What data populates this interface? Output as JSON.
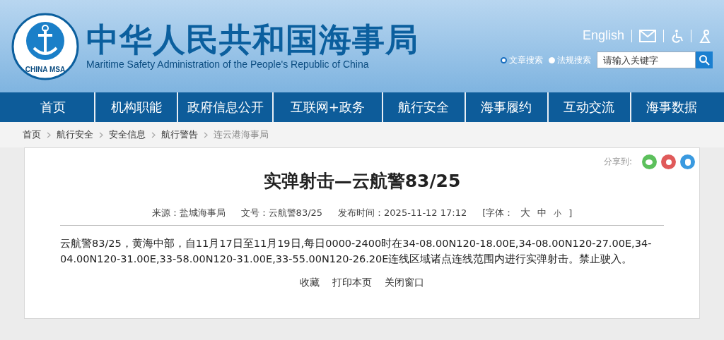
{
  "header": {
    "logo_text": "CHINA MSA",
    "title": "中华人民共和国海事局",
    "subtitle": "Maritime Safety Administration of the People's Republic of China",
    "language_link": "English",
    "search_scopes": [
      {
        "label": "文章搜索",
        "selected": true
      },
      {
        "label": "法规搜索",
        "selected": false
      }
    ],
    "search": {
      "placeholder": "请输入关键字"
    }
  },
  "nav": [
    {
      "label": "首页"
    },
    {
      "label": "机构职能"
    },
    {
      "label": "政府信息公开"
    },
    {
      "label": "互联网+政务"
    },
    {
      "label": "航行安全"
    },
    {
      "label": "海事履约"
    },
    {
      "label": "互动交流"
    },
    {
      "label": "海事数据"
    }
  ],
  "breadcrumb": [
    "首页",
    "航行安全",
    "安全信息",
    "航行警告",
    "连云港海事局"
  ],
  "article": {
    "share_label": "分享到:",
    "title": "实弹射击—云航警83/25",
    "meta": [
      {
        "text": "来源：盐城海事局"
      },
      {
        "text": "文号：云航警83/25"
      },
      {
        "text": "发布时间：2025-11-12 17:12"
      }
    ],
    "font_size": {
      "open": "[字体：",
      "options": [
        "大",
        "中",
        "小"
      ],
      "close": "]"
    },
    "body": "云航警83/25，黄海中部，自11月17日至11月19日,每日0000-2400时在34-08.00N120-18.00E,34-08.00N120-27.00E,34-04.00N120-31.00E,33-58.00N120-31.00E,33-55.00N120-26.20E连线区域诸点连线范围内进行实弹射击。禁止驶入。",
    "actions": [
      "收藏",
      "打印本页",
      "关闭窗口"
    ]
  }
}
